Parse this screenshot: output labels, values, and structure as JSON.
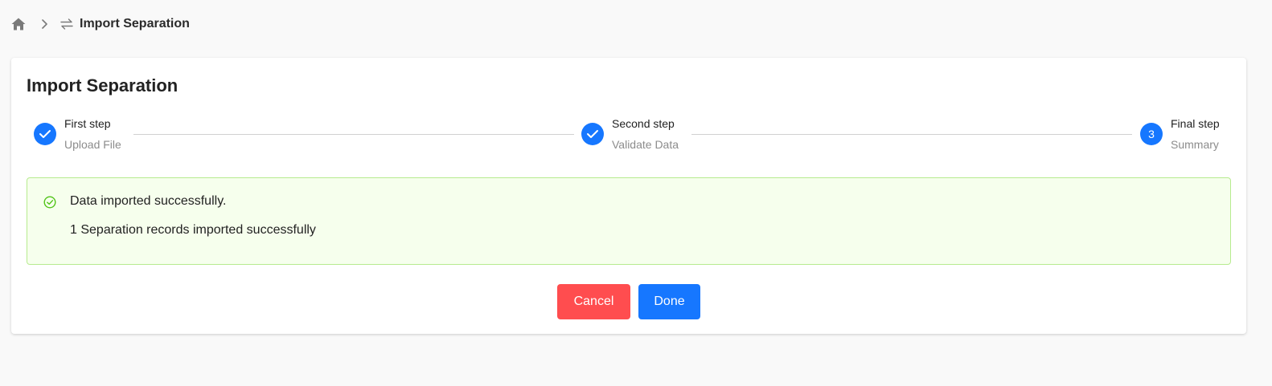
{
  "breadcrumb": {
    "home_icon": "home-icon",
    "separator_icon": "chevron-right-icon",
    "module_icon": "swap-arrows-icon",
    "title": "Import Separation"
  },
  "card": {
    "title": "Import Separation"
  },
  "steps": [
    {
      "title": "First step",
      "subtitle": "Upload File",
      "status": "finished",
      "icon": "check-icon"
    },
    {
      "title": "Second step",
      "subtitle": "Validate Data",
      "status": "finished",
      "icon": "check-icon"
    },
    {
      "title": "Final step",
      "subtitle": "Summary",
      "status": "current",
      "number": "3"
    }
  ],
  "alert": {
    "icon": "check-circle-icon",
    "title": "Data imported successfully.",
    "description": "1 Separation records imported successfully",
    "color": "#52c41a"
  },
  "buttons": {
    "cancel_label": "Cancel",
    "done_label": "Done"
  },
  "colors": {
    "primary": "#1677ff",
    "danger": "#ff4d4f",
    "success_bg": "#f6ffed",
    "success_border": "#b7eb8f"
  }
}
